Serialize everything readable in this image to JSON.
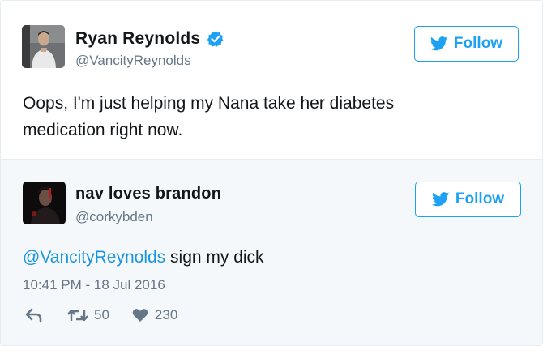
{
  "main_tweet": {
    "display_name": "Ryan Reynolds",
    "handle": "@VancityReynolds",
    "verified": true,
    "text": "Oops, I'm just helping my Nana take her diabetes medication right now.",
    "follow_label": "Follow",
    "avatar_icon": "profile-photo-icon"
  },
  "reply_tweet": {
    "display_name": "nav loves brandon",
    "handle": "@corkybden",
    "mention": "@VancityReynolds",
    "text": " sign my dick",
    "follow_label": "Follow",
    "timestamp": "10:41 PM - 18 Jul 2016",
    "retweet_count": "50",
    "like_count": "230",
    "avatar_icon": "profile-photo-icon"
  },
  "colors": {
    "accent": "#1da1f2",
    "mention": "#1b95e0",
    "secondary_text": "#657786",
    "reply_background": "#f5f8fa"
  }
}
